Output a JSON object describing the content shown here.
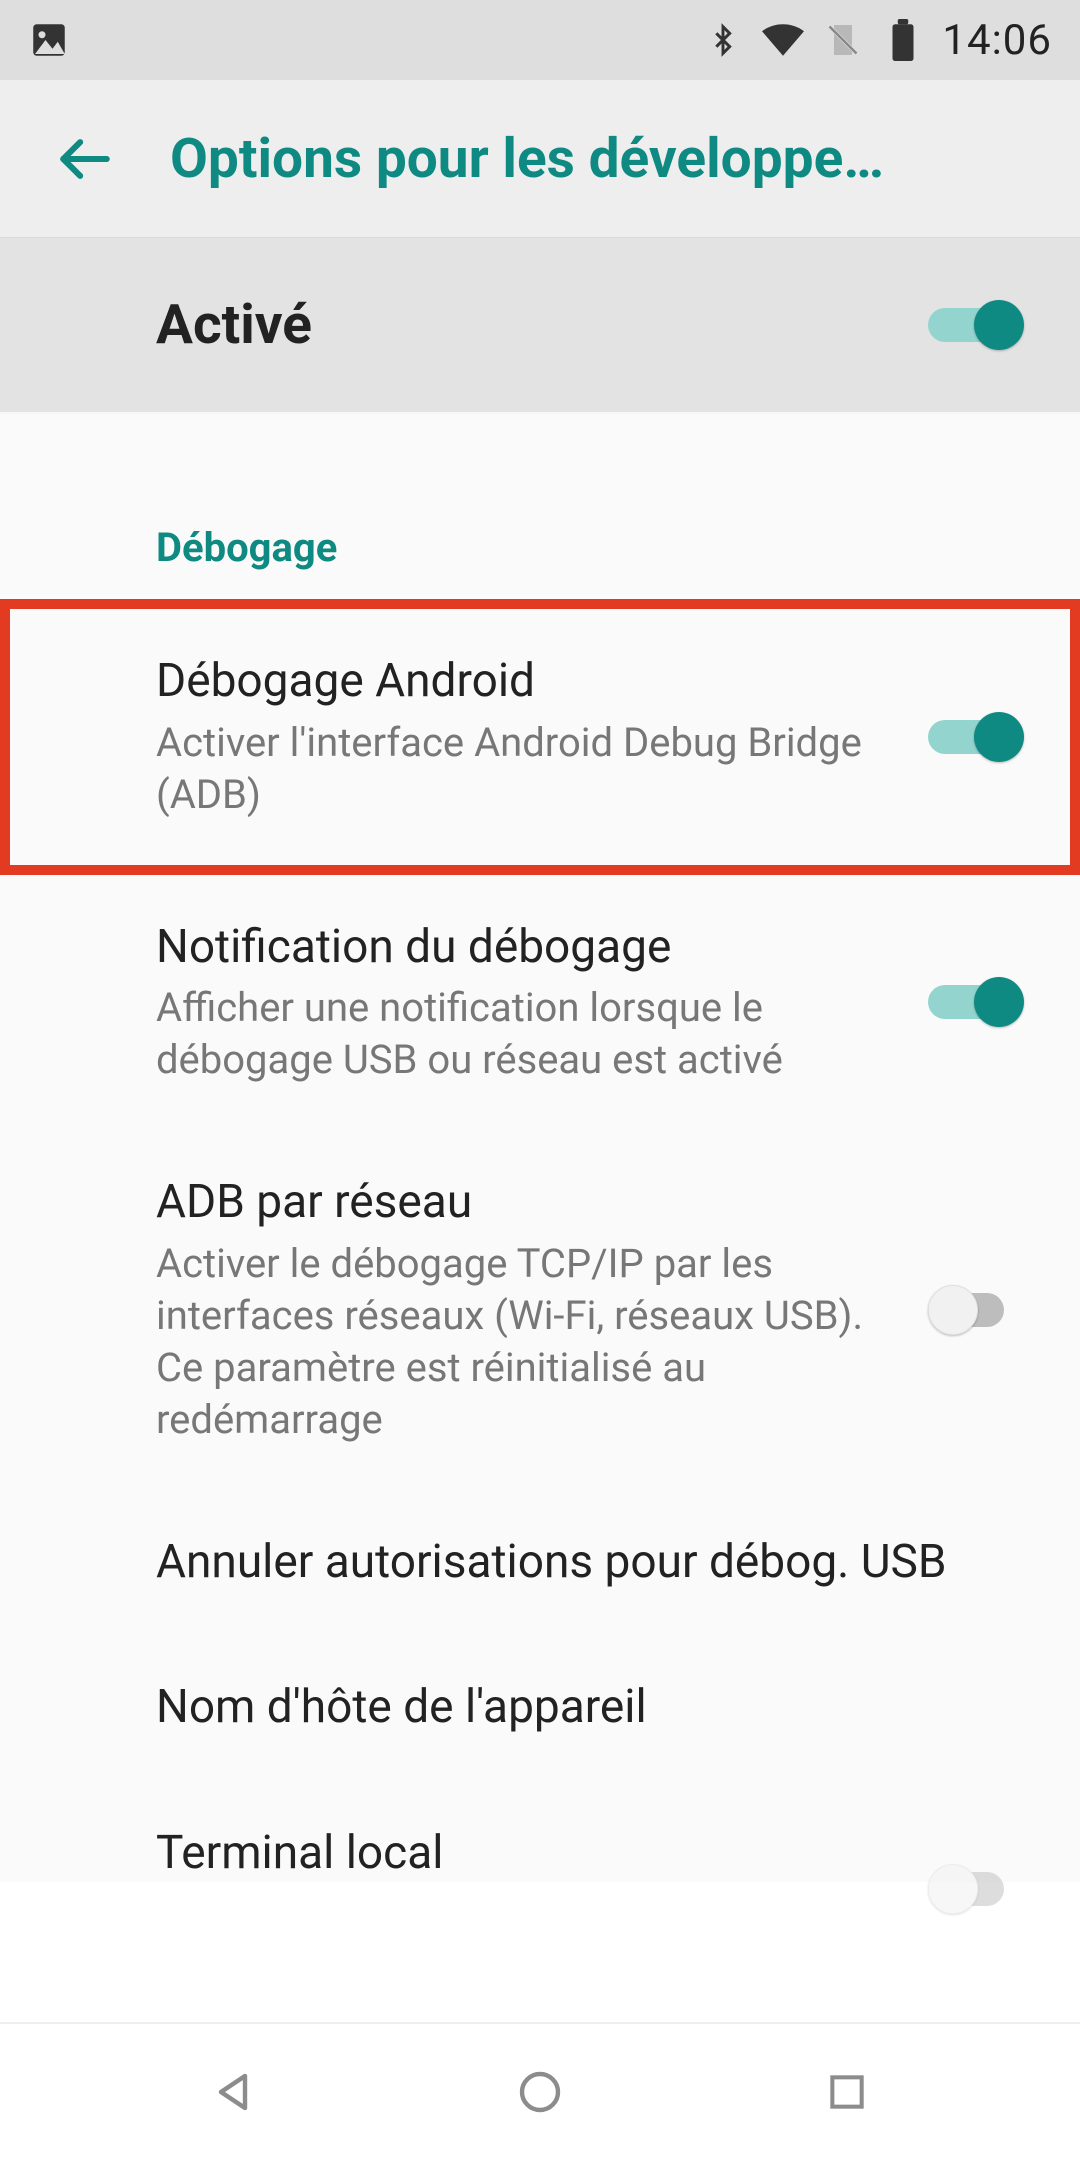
{
  "status": {
    "time": "14:06",
    "icons": {
      "picture": "picture-icon",
      "bluetooth": "bluetooth-icon",
      "wifi": "wifi-icon",
      "sim_off": "no-sim-icon",
      "battery": "battery-icon"
    }
  },
  "app_bar": {
    "title": "Options pour les développe…"
  },
  "master_toggle": {
    "label": "Activé",
    "on": true
  },
  "section_header": "Débogage",
  "settings": [
    {
      "key": "android_debugging",
      "title": "Débogage Android",
      "desc": "Activer l'interface Android Debug Bridge (ADB)",
      "has_switch": true,
      "on": true,
      "highlight": true
    },
    {
      "key": "debug_notification",
      "title": "Notification du débogage",
      "desc": "Afficher une notification lorsque le débogage USB ou réseau est activé",
      "has_switch": true,
      "on": true
    },
    {
      "key": "adb_network",
      "title": "ADB par réseau",
      "desc": "Activer le débogage TCP/IP par les interfaces réseaux (Wi-Fi, réseaux USB). Ce paramètre est réinitialisé au redémarrage",
      "has_switch": true,
      "on": false
    },
    {
      "key": "revoke_usb",
      "title": "Annuler autorisations pour débog. USB",
      "desc": "",
      "has_switch": false
    },
    {
      "key": "device_hostname",
      "title": "Nom d'hôte de l'appareil",
      "desc": "",
      "has_switch": false
    },
    {
      "key": "local_terminal",
      "title": "Terminal local",
      "desc": "",
      "has_switch": true,
      "on": false,
      "partial": true
    }
  ]
}
